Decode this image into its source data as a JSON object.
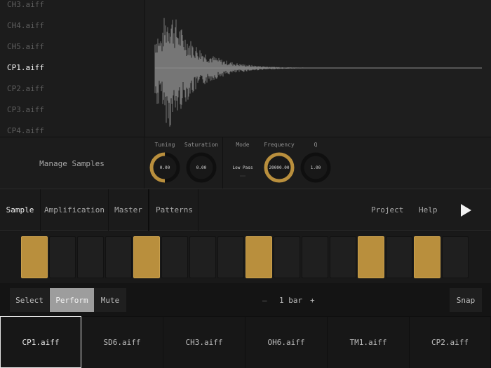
{
  "sample_list": {
    "items": [
      {
        "label": "CH3.aiff",
        "active": false
      },
      {
        "label": "CH4.aiff",
        "active": false
      },
      {
        "label": "CH5.aiff",
        "active": false
      },
      {
        "label": "CP1.aiff",
        "active": true
      },
      {
        "label": "CP2.aiff",
        "active": false
      },
      {
        "label": "CP3.aiff",
        "active": false
      },
      {
        "label": "CP4.aiff",
        "active": false
      }
    ]
  },
  "manage_samples_label": "Manage Samples",
  "knobs": {
    "tuning": {
      "label": "Tuning",
      "value": "0.00",
      "level": 0.5
    },
    "saturation": {
      "label": "Saturation",
      "value": "0.00",
      "level": 0
    },
    "mode": {
      "label": "Mode",
      "value": "Low Pass"
    },
    "frequency": {
      "label": "Frequency",
      "value": "20000.00",
      "level": 1
    },
    "q": {
      "label": "Q",
      "value": "1.00",
      "level": 0
    }
  },
  "tabs": [
    {
      "label": "Sample",
      "active": true
    },
    {
      "label": "Amplification",
      "active": false
    },
    {
      "label": "Master",
      "active": false
    },
    {
      "label": "Patterns",
      "active": false
    }
  ],
  "links": {
    "project": "Project",
    "help": "Help"
  },
  "steps": [
    true,
    false,
    false,
    false,
    true,
    false,
    false,
    false,
    true,
    false,
    false,
    false,
    true,
    false,
    true,
    false
  ],
  "controls": {
    "select": "Select",
    "perform": "Perform",
    "mute": "Mute",
    "minus": "–",
    "bar_value": "1 bar",
    "plus": "+",
    "snap": "Snap"
  },
  "tracks": [
    {
      "label": "CP1.aiff",
      "active": true
    },
    {
      "label": "SD6.aiff",
      "active": false
    },
    {
      "label": "CH3.aiff",
      "active": false
    },
    {
      "label": "OH6.aiff",
      "active": false
    },
    {
      "label": "TM1.aiff",
      "active": false
    },
    {
      "label": "CP2.aiff",
      "active": false
    }
  ],
  "colors": {
    "accent": "#b98f3d",
    "knob_track": "#0f0f0f",
    "waveform": "#8c8c8c"
  },
  "icons": {
    "play": "play-icon"
  }
}
